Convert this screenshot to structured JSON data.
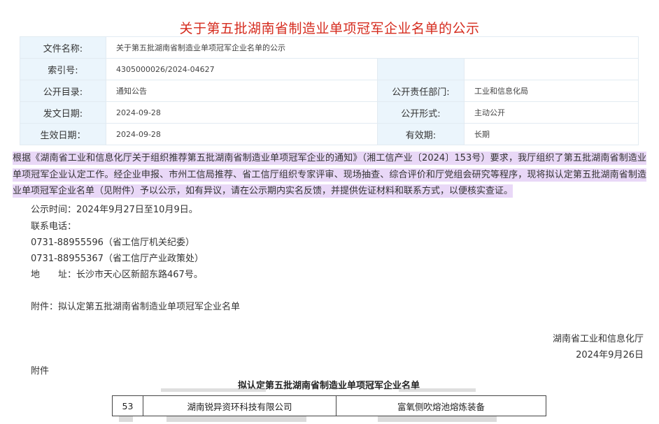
{
  "doc": {
    "title": "关于第五批湖南省制造业单项冠军企业名单的公示"
  },
  "meta": {
    "filename_label": "文件名称:",
    "filename_value": "关于第五批湖南省制造业单项冠军企业名单的公示",
    "index_label": "索引号:",
    "index_value": "4305000026/2024-04627",
    "catalog_label": "公开目录:",
    "catalog_value": "通知公告",
    "dept_label": "公开责任部门:",
    "dept_value": "工业和信息化局",
    "date_label": "发文日期:",
    "date_value": "2024-09-28",
    "form_label": "公开形式:",
    "form_value": "主动公开",
    "effective_label": "生效日期：",
    "effective_value": "2024-09-28",
    "validity_label": "有效期:",
    "validity_value": "长期"
  },
  "body": {
    "paragraph": "根据《湖南省工业和信息化厅关于组织推荐第五批湖南省制造业单项冠军企业的通知》（湘工信产业〔2024〕153号）要求，我厅组织了第五批湖南省制造业单项冠军企业认定工作。经企业申报、市州工信局推荐、省工信厅组织专家评审、现场抽查、综合评价和厅党组会研究等程序，现将拟认定第五批湖南省制造业单项冠军企业名单（见附件）予以公示，如有异议，请在公示期内实名反馈，并提供佐证材料和联系方式，以便核实查证。",
    "notice_time": "公示时间：2024年9月27日至10月9日。",
    "contact_label": "联系电话：",
    "phone1": "0731-88955596（省工信厅机关纪委）",
    "phone2": "0731-88955367（省工信厅产业政策处）",
    "address": "地　　址：长沙市天心区新韶东路467号。",
    "attachment": "附件：拟认定第五批湖南省制造业单项冠军企业名单",
    "sign_org": "湖南省工业和信息化厅",
    "sign_date": "2024年9月26日",
    "attach_heading": "附件"
  },
  "attachment_table": {
    "title": "拟认定第五批湖南省制造业单项冠军企业名单",
    "row": {
      "no": "53",
      "company": "湖南锐异资环科技有限公司",
      "product": "富氧侧吹熔池熔炼装备"
    }
  }
}
